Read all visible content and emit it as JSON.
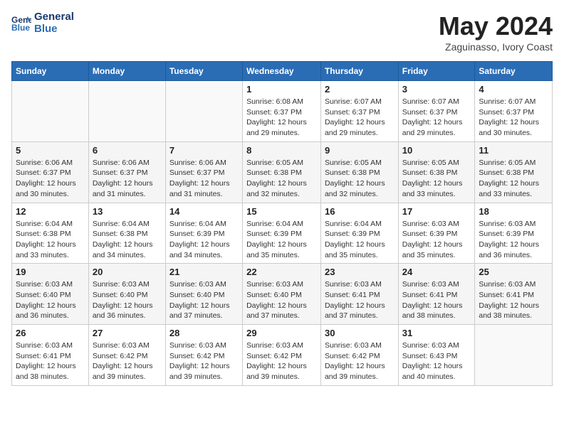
{
  "header": {
    "logo_line1": "General",
    "logo_line2": "Blue",
    "title": "May 2024",
    "subtitle": "Zaguinasso, Ivory Coast"
  },
  "days_of_week": [
    "Sunday",
    "Monday",
    "Tuesday",
    "Wednesday",
    "Thursday",
    "Friday",
    "Saturday"
  ],
  "weeks": [
    [
      {
        "day": "",
        "info": ""
      },
      {
        "day": "",
        "info": ""
      },
      {
        "day": "",
        "info": ""
      },
      {
        "day": "1",
        "info": "Sunrise: 6:08 AM\nSunset: 6:37 PM\nDaylight: 12 hours\nand 29 minutes."
      },
      {
        "day": "2",
        "info": "Sunrise: 6:07 AM\nSunset: 6:37 PM\nDaylight: 12 hours\nand 29 minutes."
      },
      {
        "day": "3",
        "info": "Sunrise: 6:07 AM\nSunset: 6:37 PM\nDaylight: 12 hours\nand 29 minutes."
      },
      {
        "day": "4",
        "info": "Sunrise: 6:07 AM\nSunset: 6:37 PM\nDaylight: 12 hours\nand 30 minutes."
      }
    ],
    [
      {
        "day": "5",
        "info": "Sunrise: 6:06 AM\nSunset: 6:37 PM\nDaylight: 12 hours\nand 30 minutes."
      },
      {
        "day": "6",
        "info": "Sunrise: 6:06 AM\nSunset: 6:37 PM\nDaylight: 12 hours\nand 31 minutes."
      },
      {
        "day": "7",
        "info": "Sunrise: 6:06 AM\nSunset: 6:37 PM\nDaylight: 12 hours\nand 31 minutes."
      },
      {
        "day": "8",
        "info": "Sunrise: 6:05 AM\nSunset: 6:38 PM\nDaylight: 12 hours\nand 32 minutes."
      },
      {
        "day": "9",
        "info": "Sunrise: 6:05 AM\nSunset: 6:38 PM\nDaylight: 12 hours\nand 32 minutes."
      },
      {
        "day": "10",
        "info": "Sunrise: 6:05 AM\nSunset: 6:38 PM\nDaylight: 12 hours\nand 33 minutes."
      },
      {
        "day": "11",
        "info": "Sunrise: 6:05 AM\nSunset: 6:38 PM\nDaylight: 12 hours\nand 33 minutes."
      }
    ],
    [
      {
        "day": "12",
        "info": "Sunrise: 6:04 AM\nSunset: 6:38 PM\nDaylight: 12 hours\nand 33 minutes."
      },
      {
        "day": "13",
        "info": "Sunrise: 6:04 AM\nSunset: 6:38 PM\nDaylight: 12 hours\nand 34 minutes."
      },
      {
        "day": "14",
        "info": "Sunrise: 6:04 AM\nSunset: 6:39 PM\nDaylight: 12 hours\nand 34 minutes."
      },
      {
        "day": "15",
        "info": "Sunrise: 6:04 AM\nSunset: 6:39 PM\nDaylight: 12 hours\nand 35 minutes."
      },
      {
        "day": "16",
        "info": "Sunrise: 6:04 AM\nSunset: 6:39 PM\nDaylight: 12 hours\nand 35 minutes."
      },
      {
        "day": "17",
        "info": "Sunrise: 6:03 AM\nSunset: 6:39 PM\nDaylight: 12 hours\nand 35 minutes."
      },
      {
        "day": "18",
        "info": "Sunrise: 6:03 AM\nSunset: 6:39 PM\nDaylight: 12 hours\nand 36 minutes."
      }
    ],
    [
      {
        "day": "19",
        "info": "Sunrise: 6:03 AM\nSunset: 6:40 PM\nDaylight: 12 hours\nand 36 minutes."
      },
      {
        "day": "20",
        "info": "Sunrise: 6:03 AM\nSunset: 6:40 PM\nDaylight: 12 hours\nand 36 minutes."
      },
      {
        "day": "21",
        "info": "Sunrise: 6:03 AM\nSunset: 6:40 PM\nDaylight: 12 hours\nand 37 minutes."
      },
      {
        "day": "22",
        "info": "Sunrise: 6:03 AM\nSunset: 6:40 PM\nDaylight: 12 hours\nand 37 minutes."
      },
      {
        "day": "23",
        "info": "Sunrise: 6:03 AM\nSunset: 6:41 PM\nDaylight: 12 hours\nand 37 minutes."
      },
      {
        "day": "24",
        "info": "Sunrise: 6:03 AM\nSunset: 6:41 PM\nDaylight: 12 hours\nand 38 minutes."
      },
      {
        "day": "25",
        "info": "Sunrise: 6:03 AM\nSunset: 6:41 PM\nDaylight: 12 hours\nand 38 minutes."
      }
    ],
    [
      {
        "day": "26",
        "info": "Sunrise: 6:03 AM\nSunset: 6:41 PM\nDaylight: 12 hours\nand 38 minutes."
      },
      {
        "day": "27",
        "info": "Sunrise: 6:03 AM\nSunset: 6:42 PM\nDaylight: 12 hours\nand 39 minutes."
      },
      {
        "day": "28",
        "info": "Sunrise: 6:03 AM\nSunset: 6:42 PM\nDaylight: 12 hours\nand 39 minutes."
      },
      {
        "day": "29",
        "info": "Sunrise: 6:03 AM\nSunset: 6:42 PM\nDaylight: 12 hours\nand 39 minutes."
      },
      {
        "day": "30",
        "info": "Sunrise: 6:03 AM\nSunset: 6:42 PM\nDaylight: 12 hours\nand 39 minutes."
      },
      {
        "day": "31",
        "info": "Sunrise: 6:03 AM\nSunset: 6:43 PM\nDaylight: 12 hours\nand 40 minutes."
      },
      {
        "day": "",
        "info": ""
      }
    ]
  ]
}
